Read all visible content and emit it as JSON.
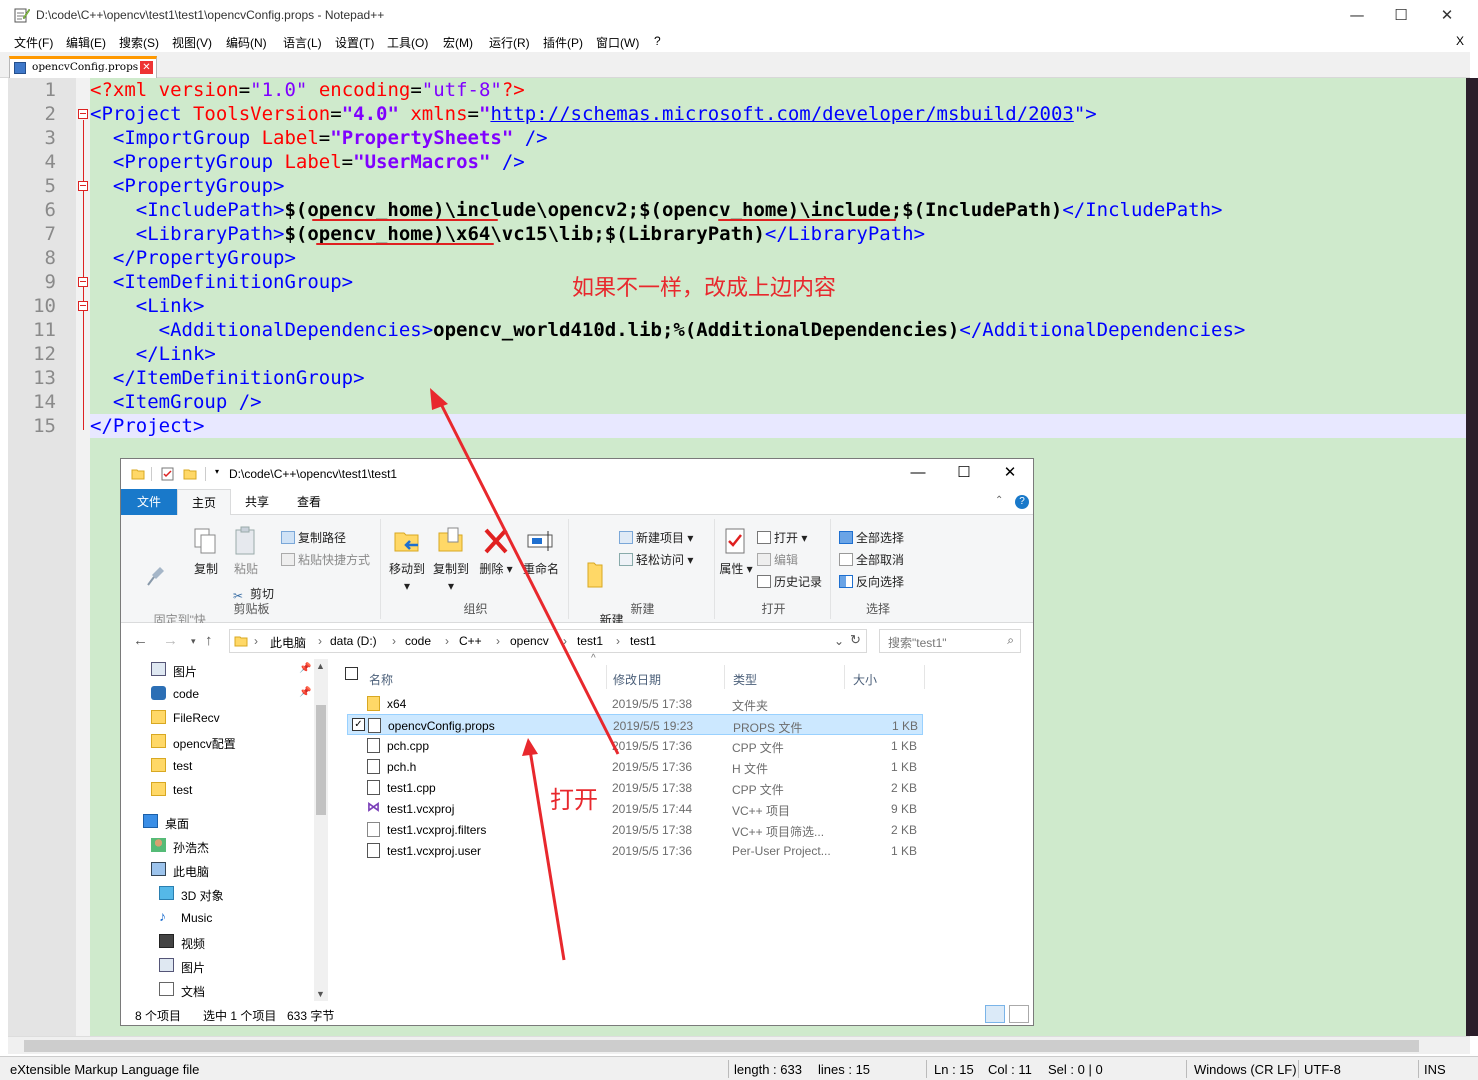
{
  "window": {
    "title": "D:\\code\\C++\\opencv\\test1\\test1\\opencvConfig.props - Notepad++",
    "minimize": "—",
    "maximize": "☐",
    "close": "✕"
  },
  "menu": {
    "items": [
      "文件(F)",
      "编辑(E)",
      "搜索(S)",
      "视图(V)",
      "编码(N)",
      "语言(L)",
      "设置(T)",
      "工具(O)",
      "宏(M)",
      "运行(R)",
      "插件(P)",
      "窗口(W)",
      "?"
    ],
    "close_doc": "X"
  },
  "tab": {
    "label": "opencvConfig.props",
    "close": "✕"
  },
  "editor": {
    "line_numbers": [
      "1",
      "2",
      "3",
      "4",
      "5",
      "6",
      "7",
      "8",
      "9",
      "10",
      "11",
      "12",
      "13",
      "14",
      "15"
    ],
    "lines": {
      "l1": {
        "a": "<?xml ",
        "b": "version",
        "c": "=",
        "d": "\"1.0\"",
        "e": " encoding",
        "f": "=",
        "g": "\"utf-8\"",
        "h": "?>"
      },
      "l2": {
        "a": "<Project ",
        "b": "ToolsVersion",
        "c": "=",
        "d": "\"4.0\"",
        "e": " xmlns",
        "f": "=",
        "g": "\"",
        "h": "http://schemas.microsoft.com/developer/msbuild/2003",
        "i": "\">"
      },
      "l3": {
        "a": "  <ImportGroup ",
        "b": "Label",
        "c": "=",
        "d": "\"PropertySheets\"",
        "e": " />"
      },
      "l4": {
        "a": "  <PropertyGroup ",
        "b": "Label",
        "c": "=",
        "d": "\"UserMacros\"",
        "e": " />"
      },
      "l5": {
        "a": "  <PropertyGroup>"
      },
      "l6": {
        "a": "    <IncludePath>",
        "b": "$(opencv_home)\\include\\opencv2;$(opencv_home)\\include;$(IncludePath)",
        "c": "</IncludePath>"
      },
      "l7": {
        "a": "    <LibraryPath>",
        "b": "$(opencv_home)\\x64\\vc15\\lib;$(LibraryPath)",
        "c": "</LibraryPath>"
      },
      "l8": {
        "a": "  </PropertyGroup>"
      },
      "l9": {
        "a": "  <ItemDefinitionGroup>"
      },
      "l10": {
        "a": "    <Link>"
      },
      "l11": {
        "a": "      <AdditionalDependencies>",
        "b": "opencv_world410d.lib;%(AdditionalDependencies)",
        "c": "</AdditionalDependencies>"
      },
      "l12": {
        "a": "    </Link>"
      },
      "l13": {
        "a": "  </ItemDefinitionGroup>"
      },
      "l14": {
        "a": "  <ItemGroup />"
      },
      "l15": {
        "a": "</Project>"
      }
    }
  },
  "annotations": {
    "note_change": "如果不一样，改成上边内容",
    "note_open": "打开"
  },
  "statusbar": {
    "filetype": "eXtensible Markup Language file",
    "length": "length : 633",
    "lines": "lines : 15",
    "ln": "Ln : 15",
    "col": "Col : 11",
    "sel": "Sel : 0 | 0",
    "eol": "Windows (CR LF)",
    "encoding": "UTF-8",
    "mode": "INS"
  },
  "explorer": {
    "title_path": "D:\\code\\C++\\opencv\\test1\\test1",
    "ribbon_tabs": [
      "文件",
      "主页",
      "共享",
      "查看"
    ],
    "ribbon": {
      "pin": "固定到\"快\n速访问\"",
      "copy": "复制",
      "paste": "粘贴",
      "copy_path": "复制路径",
      "paste_shortcut": "粘贴快捷方式",
      "cut": "剪切",
      "clipboard": "剪贴板",
      "move_to": "移动到",
      "copy_to": "复制到",
      "delete": "删除",
      "rename": "重命名",
      "organize": "组织",
      "new_folder": "新建\n文件夹",
      "new_item": "新建项目",
      "easy_access": "轻松访问",
      "new_group": "新建",
      "properties": "属性",
      "open": "打开",
      "edit": "编辑",
      "history": "历史记录",
      "open_group": "打开",
      "select_all": "全部选择",
      "select_none": "全部取消",
      "invert": "反向选择",
      "select_group": "选择"
    },
    "breadcrumb": [
      "此电脑",
      "data (D:)",
      "code",
      "C++",
      "opencv",
      "test1",
      "test1"
    ],
    "search_placeholder": "搜索\"test1\"",
    "nav": [
      "图片",
      "code",
      "FileRecv",
      "opencv配置",
      "test",
      "test",
      "桌面",
      "孙浩杰",
      "此电脑",
      "3D 对象",
      "Music",
      "视频",
      "图片",
      "文档"
    ],
    "columns": [
      "名称",
      "修改日期",
      "类型",
      "大小"
    ],
    "files": [
      {
        "name": "x64",
        "date": "2019/5/5 17:38",
        "type": "文件夹",
        "size": ""
      },
      {
        "name": "opencvConfig.props",
        "date": "2019/5/5 19:23",
        "type": "PROPS 文件",
        "size": "1 KB"
      },
      {
        "name": "pch.cpp",
        "date": "2019/5/5 17:36",
        "type": "CPP 文件",
        "size": "1 KB"
      },
      {
        "name": "pch.h",
        "date": "2019/5/5 17:36",
        "type": "H 文件",
        "size": "1 KB"
      },
      {
        "name": "test1.cpp",
        "date": "2019/5/5 17:38",
        "type": "CPP 文件",
        "size": "2 KB"
      },
      {
        "name": "test1.vcxproj",
        "date": "2019/5/5 17:44",
        "type": "VC++ 项目",
        "size": "9 KB"
      },
      {
        "name": "test1.vcxproj.filters",
        "date": "2019/5/5 17:38",
        "type": "VC++ 项目筛选...",
        "size": "2 KB"
      },
      {
        "name": "test1.vcxproj.user",
        "date": "2019/5/5 17:36",
        "type": "Per-User Project...",
        "size": "1 KB"
      }
    ],
    "status": {
      "count": "8 个项目",
      "selected": "选中 1 个项目",
      "size": "633 字节"
    }
  }
}
